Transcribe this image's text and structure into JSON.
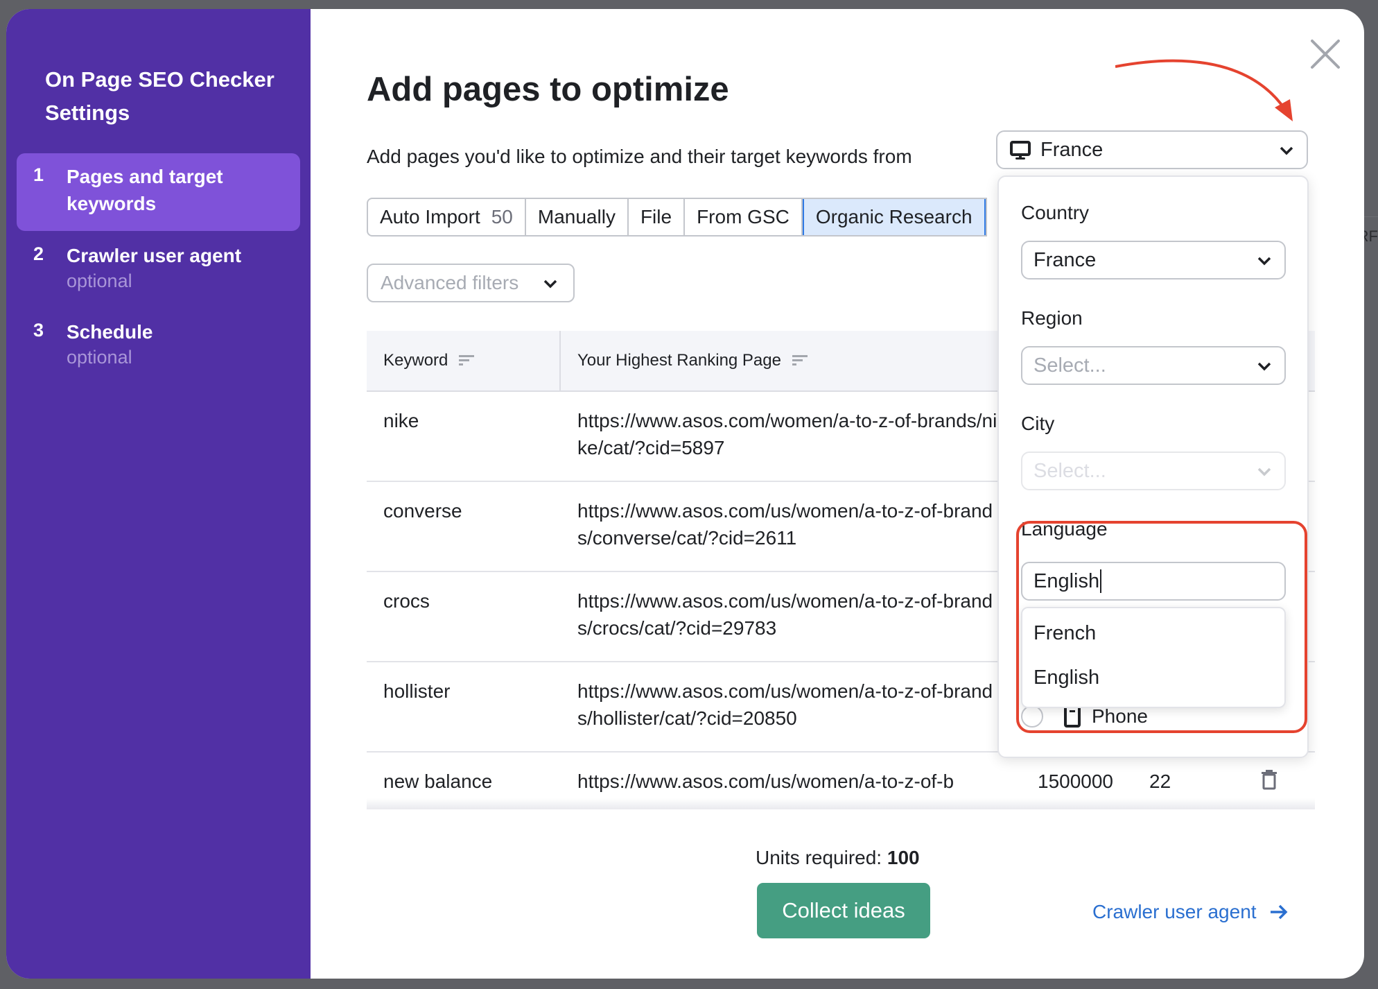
{
  "background": {
    "partial_text": "RF"
  },
  "sidebar": {
    "title": "On Page SEO Checker Settings",
    "steps": [
      {
        "number": "1",
        "label": "Pages and target keywords",
        "sub": "",
        "active": true
      },
      {
        "number": "2",
        "label": "Crawler user agent",
        "sub": "optional",
        "active": false
      },
      {
        "number": "3",
        "label": "Schedule",
        "sub": "optional",
        "active": false
      }
    ]
  },
  "main": {
    "title": "Add pages to optimize",
    "subtitle": "Add pages you'd like to optimize and their target keywords from",
    "database_select": {
      "icon": "monitor-icon",
      "value": "France"
    },
    "tabs": [
      {
        "label": "Auto Import",
        "count": "50",
        "active": false
      },
      {
        "label": "Manually",
        "active": false
      },
      {
        "label": "File",
        "active": false
      },
      {
        "label": "From GSC",
        "active": false
      },
      {
        "label": "Organic Research",
        "active": true
      }
    ],
    "advanced_filters": {
      "placeholder": "Advanced filters"
    },
    "table": {
      "columns": [
        "Keyword",
        "Your Highest Ranking Page"
      ],
      "rows": [
        {
          "keyword": "nike",
          "url": "https://www.asos.com/women/a-to-z-of-brands/nike/cat/?cid=5897",
          "volume": "",
          "kd": ""
        },
        {
          "keyword": "converse",
          "url": "https://www.asos.com/us/women/a-to-z-of-brands/converse/cat/?cid=2611",
          "volume": "",
          "kd": ""
        },
        {
          "keyword": "crocs",
          "url": "https://www.asos.com/us/women/a-to-z-of-brands/crocs/cat/?cid=29783",
          "volume": "",
          "kd": ""
        },
        {
          "keyword": "hollister",
          "url": "https://www.asos.com/us/women/a-to-z-of-brands/hollister/cat/?cid=20850",
          "volume": "",
          "kd": ""
        },
        {
          "keyword": "new balance",
          "url": "https://www.asos.com/us/women/a-to-z-of-b",
          "volume": "1500000",
          "kd": "22"
        }
      ]
    },
    "units_label": "Units required:",
    "units_value": "100",
    "collect_button": "Collect ideas",
    "next_link": "Crawler user agent"
  },
  "db_panel": {
    "country_label": "Country",
    "country_value": "France",
    "region_label": "Region",
    "region_placeholder": "Select...",
    "city_label": "City",
    "city_placeholder": "Select...",
    "language_label": "Language",
    "language_input": "English",
    "language_options": [
      "French",
      "English"
    ],
    "device_option": "Phone"
  },
  "colors": {
    "sidebar": "#5130a5",
    "sidebar_active": "#7f52d9",
    "primary_button": "#459e82",
    "link": "#2a6fd0",
    "annotation": "#e5432f",
    "active_tab": "#dbe9fc"
  }
}
